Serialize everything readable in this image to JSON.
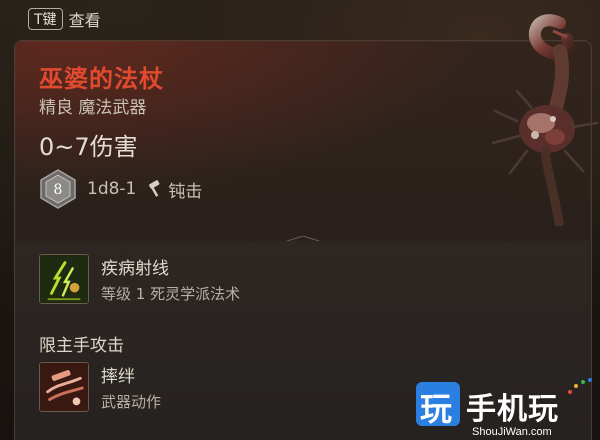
{
  "hint": {
    "key": "T键",
    "action": "查看"
  },
  "item": {
    "name": "巫婆的法杖",
    "subtitle": "精良 魔法武器",
    "damage": "0~7伤害",
    "dice_value": "8",
    "dice_formula": "1d8-1",
    "damage_type": "钝击"
  },
  "abilities": [
    {
      "title": "疾病射线",
      "desc": "等级 1 死灵学派法术",
      "icon": "sickness-ray-icon"
    },
    {
      "title": "摔绊",
      "desc": "武器动作",
      "icon": "topple-icon"
    }
  ],
  "restriction": "限主手攻击",
  "watermark": {
    "logo_char": "玩",
    "brand": "手机玩",
    "url": "ShouJiWan.com",
    "brand_color": "#2a7fe0"
  },
  "colors": {
    "item_name": "#e24a2f",
    "ability_icon_green": "#b8e02a"
  }
}
